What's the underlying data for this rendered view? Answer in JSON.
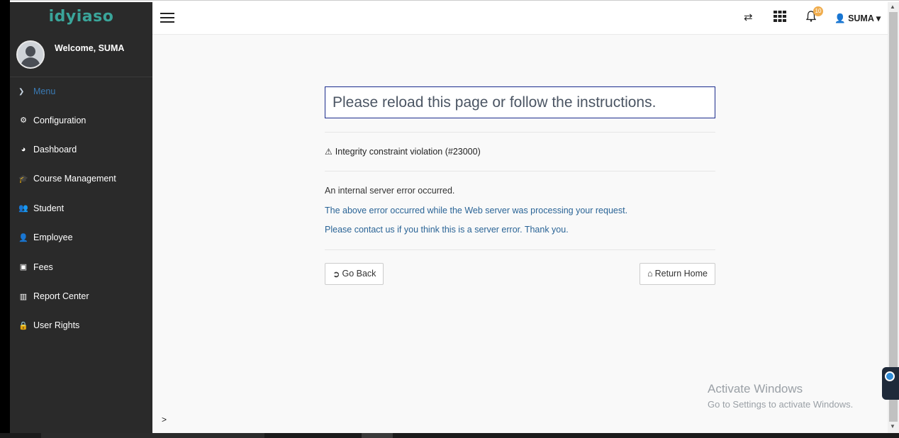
{
  "sidebar": {
    "logo_text": "idyiaso",
    "welcome": "Welcome, SUMA",
    "menu_label": "Menu",
    "items": [
      {
        "label": "Configuration",
        "icon": "⚙"
      },
      {
        "label": "Dashboard",
        "icon": "◕"
      },
      {
        "label": "Course Management",
        "icon": "🎓"
      },
      {
        "label": "Student",
        "icon": "👥"
      },
      {
        "label": "Employee",
        "icon": "👤"
      },
      {
        "label": "Fees",
        "icon": "▣"
      },
      {
        "label": "Report Center",
        "icon": "▥"
      },
      {
        "label": "User Rights",
        "icon": "🔒"
      }
    ]
  },
  "topbar": {
    "notification_count": "10",
    "user_name": "SUMA",
    "icons": [
      "translate-icon",
      "apps-grid-icon",
      "bell-icon",
      "user-icon"
    ]
  },
  "error": {
    "headline": "Please reload this page or follow the instructions.",
    "title": "Integrity constraint violation (#23000)",
    "line1": "An internal server error occurred.",
    "line2": "The above error occurred while the Web server was processing your request.",
    "line3": "Please contact us if you think this is a server error. Thank you.",
    "back_label": "Go Back",
    "home_label": "Return Home"
  },
  "watermark": {
    "title": "Activate Windows",
    "subtitle": "Go to Settings to activate Windows."
  },
  "prompt": ">",
  "colors": {
    "sidebar_bg": "#2a2a2a",
    "logo": "#3aa59a",
    "link_blue": "#2a6496",
    "alert_border": "#1a2b8c",
    "badge": "#f0ad4e"
  }
}
